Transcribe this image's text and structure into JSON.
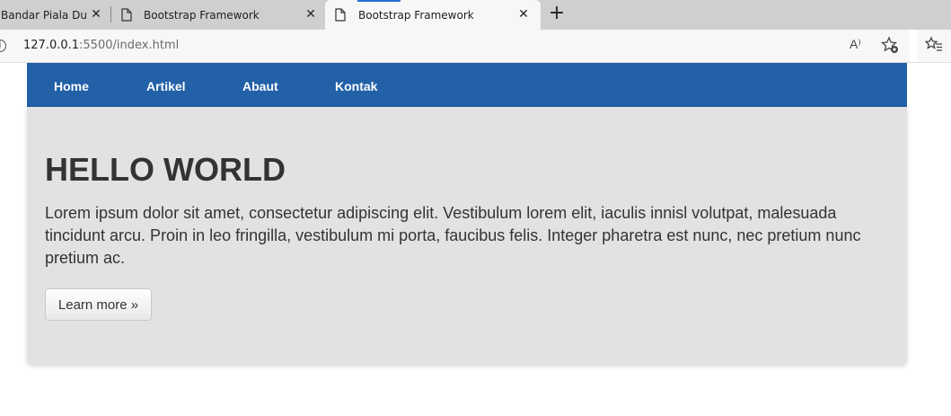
{
  "browser": {
    "tabs": [
      {
        "title": "Bandar Piala Dunia",
        "close": "✕"
      },
      {
        "title": "Bootstrap Framework",
        "close": "✕"
      },
      {
        "title": "Bootstrap Framework",
        "close": "✕",
        "active": true
      }
    ],
    "new_tab": "+",
    "address": {
      "host": "127.0.0.1",
      "path": ":5500/index.html"
    },
    "read_aloud": "A⁾",
    "info": "i"
  },
  "navbar": {
    "links": [
      "Home",
      "Artikel",
      "Abaut",
      "Kontak"
    ],
    "color": "#2260a8"
  },
  "jumbotron": {
    "title": "HELLO WORLD",
    "text": "Lorem ipsum dolor sit amet, consectetur adipiscing elit. Vestibulum lorem elit, iaculis innisl volutpat, malesuada tincidunt arcu. Proin in leo fringilla, vestibulum mi porta, faucibus felis. Integer pharetra est nunc, nec pretium nunc pretium ac.",
    "button": "Learn more »"
  }
}
